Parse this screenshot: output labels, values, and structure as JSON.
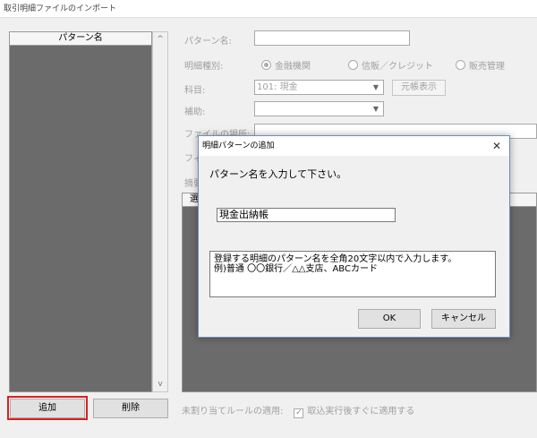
{
  "window": {
    "title": "取引明細ファイルのインポート"
  },
  "list": {
    "header": "パターン名"
  },
  "buttons": {
    "add": "追加",
    "delete": "削除"
  },
  "form": {
    "pattern_name_label": "パターン名:",
    "detail_type_label": "明細種別:",
    "detail_type_options": [
      "金融機関",
      "信販／クレジット",
      "販売管理"
    ],
    "detail_type_selected": "金融機関",
    "subject_label": "科目:",
    "subject_value": "101: 現金",
    "ledger_button": "元帳表示",
    "aux_label": "補助:",
    "file_location_label": "ファイルの場所:",
    "fi_label": "フィ",
    "summary_label": "摘要",
    "grid_header_fragment": "選"
  },
  "footer": {
    "rule_label": "未割り当てルールの適用:",
    "rule_checkbox_label": "取込実行後すぐに適用する",
    "rule_checked": true
  },
  "dialog": {
    "title": "明細パターンの追加",
    "prompt": "パターン名を入力して下さい。",
    "input_value": "現金出納帳",
    "note_line1": "登録する明細のパターン名を全角20文字以内で入力します。",
    "note_line2": "例)普通 〇〇銀行／△△支店、ABCカード",
    "ok": "OK",
    "cancel": "キャンセル"
  },
  "colors": {
    "highlight": "#d92020",
    "list_bg": "#6b6b6b",
    "dialog_border": "#6d8fb8"
  }
}
